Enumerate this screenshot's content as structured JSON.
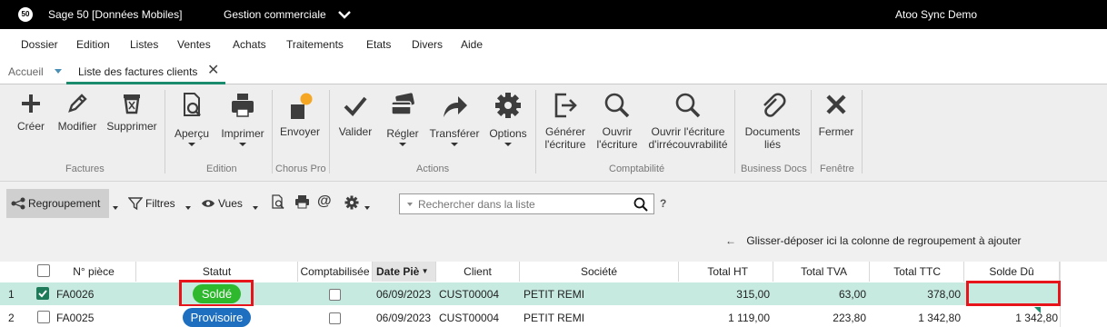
{
  "titlebar": {
    "logo": "50",
    "app_title": "Sage 50 [Données Mobiles]",
    "module": "Gestion commerciale",
    "user": "Atoo Sync Demo",
    "bg_color": "#000000"
  },
  "menu": [
    "Dossier",
    "Edition",
    "Listes",
    "Ventes",
    "Achats",
    "Traitements",
    "Etats",
    "Divers",
    "Aide"
  ],
  "tabs": {
    "home": "Accueil",
    "active": "Liste des factures clients"
  },
  "ribbon": {
    "buttons": {
      "creer": "Créer",
      "modifier": "Modifier",
      "supprimer": "Supprimer",
      "apercu": "Aperçu",
      "imprimer": "Imprimer",
      "envoyer": "Envoyer",
      "valider": "Valider",
      "regler": "Régler",
      "transferer": "Transférer",
      "options": "Options",
      "generer_1": "Générer",
      "generer_2": "l'écriture",
      "ouvrir_1": "Ouvrir",
      "ouvrir_2": "l'écriture",
      "irrec_1": "Ouvrir l'écriture",
      "irrec_2": "d'irrécouvrabilité",
      "docs_1": "Documents",
      "docs_2": "liés",
      "fermer": "Fermer"
    },
    "groups": {
      "factures": "Factures",
      "edition": "Edition",
      "chorus": "Chorus Pro",
      "actions": "Actions",
      "comptabilite": "Comptabilité",
      "business_docs": "Business Docs",
      "fenetre": "Fenêtre"
    },
    "accent_color": "#f5a623"
  },
  "toolbar": {
    "regroupement": "Regroupement",
    "filtres": "Filtres",
    "vues": "Vues",
    "search_placeholder": "Rechercher dans la liste",
    "help": "?",
    "drag_hint": "Glisser-déposer ici la colonne de regroupement à ajouter"
  },
  "grid": {
    "columns": [
      "N° pièce",
      "Statut",
      "Comptabilisée",
      "Date Piè",
      "Client",
      "Société",
      "Total HT",
      "Total TVA",
      "Total TTC",
      "Solde Dû"
    ],
    "rows": [
      {
        "num": "1",
        "selected": true,
        "piece": "FA0026",
        "statut": "Soldé",
        "statut_color": "#2db82d",
        "comptabilisee": false,
        "date": "06/09/2023",
        "client": "CUST00004",
        "societe": "PETIT REMI",
        "total_ht": "315,00",
        "total_tva": "63,00",
        "total_ttc": "378,00",
        "solde_du": ""
      },
      {
        "num": "2",
        "selected": false,
        "piece": "FA0025",
        "statut": "Provisoire",
        "statut_color": "#1e6fbf",
        "comptabilisee": false,
        "date": "06/09/2023",
        "client": "CUST00004",
        "societe": "PETIT REMI",
        "total_ht": "1 119,00",
        "total_tva": "223,80",
        "total_ttc": "1 342,80",
        "solde_du": "1 342,80"
      }
    ],
    "selected_row_color": "#c6e9e0",
    "highlight_color": "#e8141b"
  }
}
